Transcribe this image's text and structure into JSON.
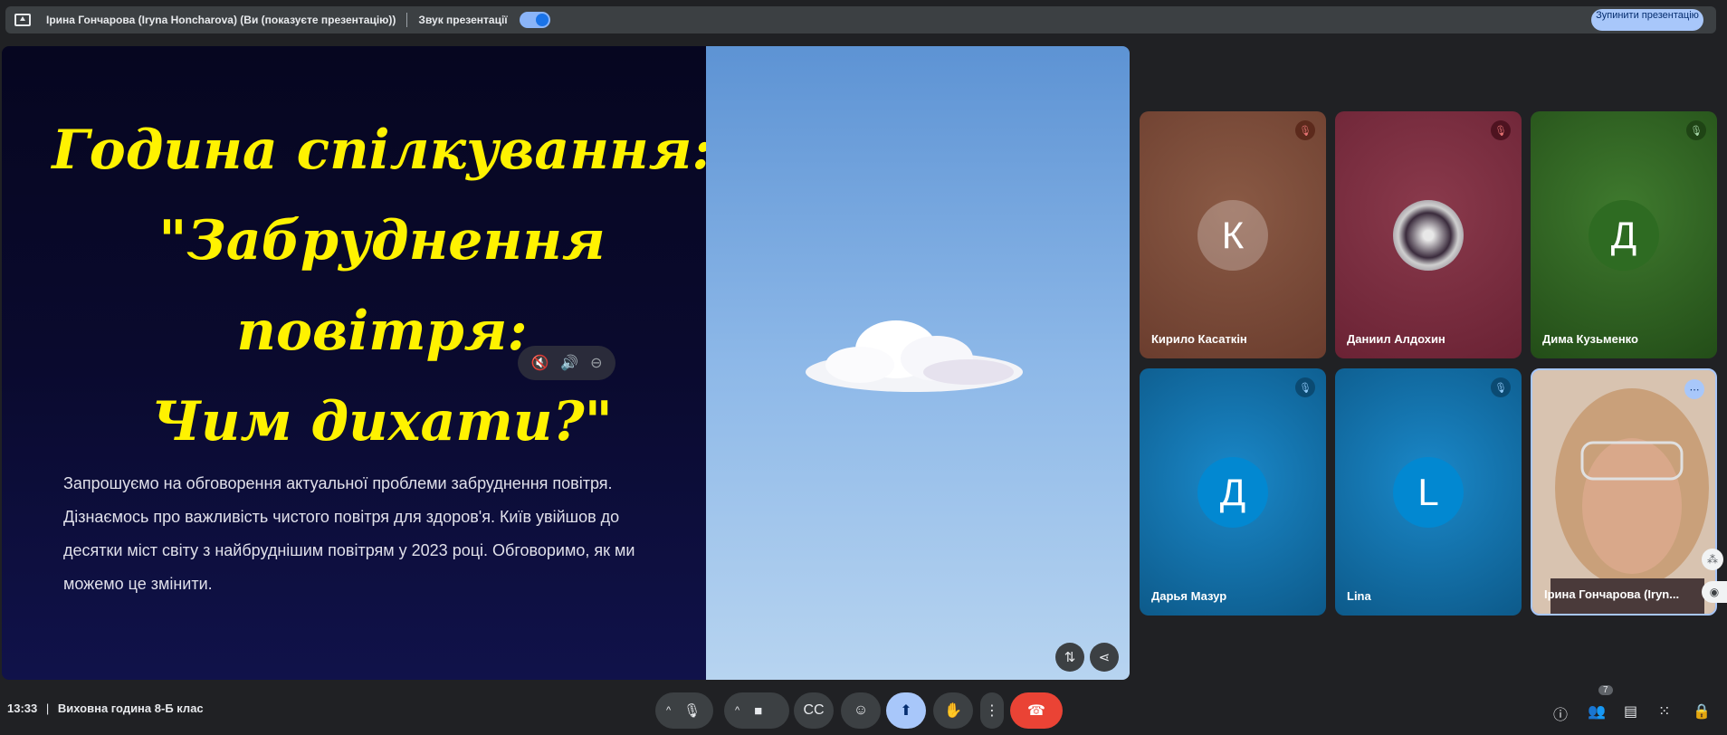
{
  "topbar": {
    "presenter": "Ірина Гончарова (Iryna Honcharova) (Ви (показуєте презентацію))",
    "audio_label": "Звук презентації",
    "stop_button": "Зупинити презентацію"
  },
  "slide": {
    "title_line1": "Година спілкування:",
    "title_line2": "\"Забруднення повітря:",
    "title_line3": "Чим дихати?\"",
    "description": "Запрошуємо на обговорення актуальної проблеми забруднення повітря. Дізнаємось про важливість чистого повітря для здоров'я. Київ увійшов до десятки міст світу з найбруднішим повітрям у 2023 році. Обговоримо, як ми можемо це змінити.",
    "title_color": "#fff200"
  },
  "participants": [
    {
      "name": "Кирило Касаткін",
      "initial": "К",
      "muted": true
    },
    {
      "name": "Даниил Алдохин",
      "initial": "",
      "muted": true
    },
    {
      "name": "Дима Кузьменко",
      "initial": "Д",
      "muted": true
    },
    {
      "name": "Дарья Мазур",
      "initial": "Д",
      "muted": true
    },
    {
      "name": "Lina",
      "initial": "L",
      "muted": true
    },
    {
      "name": "Ірина Гончарова (Iryn...",
      "initial": "",
      "muted": false
    }
  ],
  "bottombar": {
    "time": "13:33",
    "separator": "|",
    "meeting_name": "Виховна година 8-Б клас",
    "people_count": "7"
  },
  "icons": {
    "mic": "mic-icon",
    "camera": "camera-icon",
    "captions": "captions-icon",
    "emoji": "emoji-icon",
    "present": "present-icon",
    "hand": "raise-hand-icon",
    "more": "more-vert-icon",
    "end_call": "end-call-icon"
  }
}
